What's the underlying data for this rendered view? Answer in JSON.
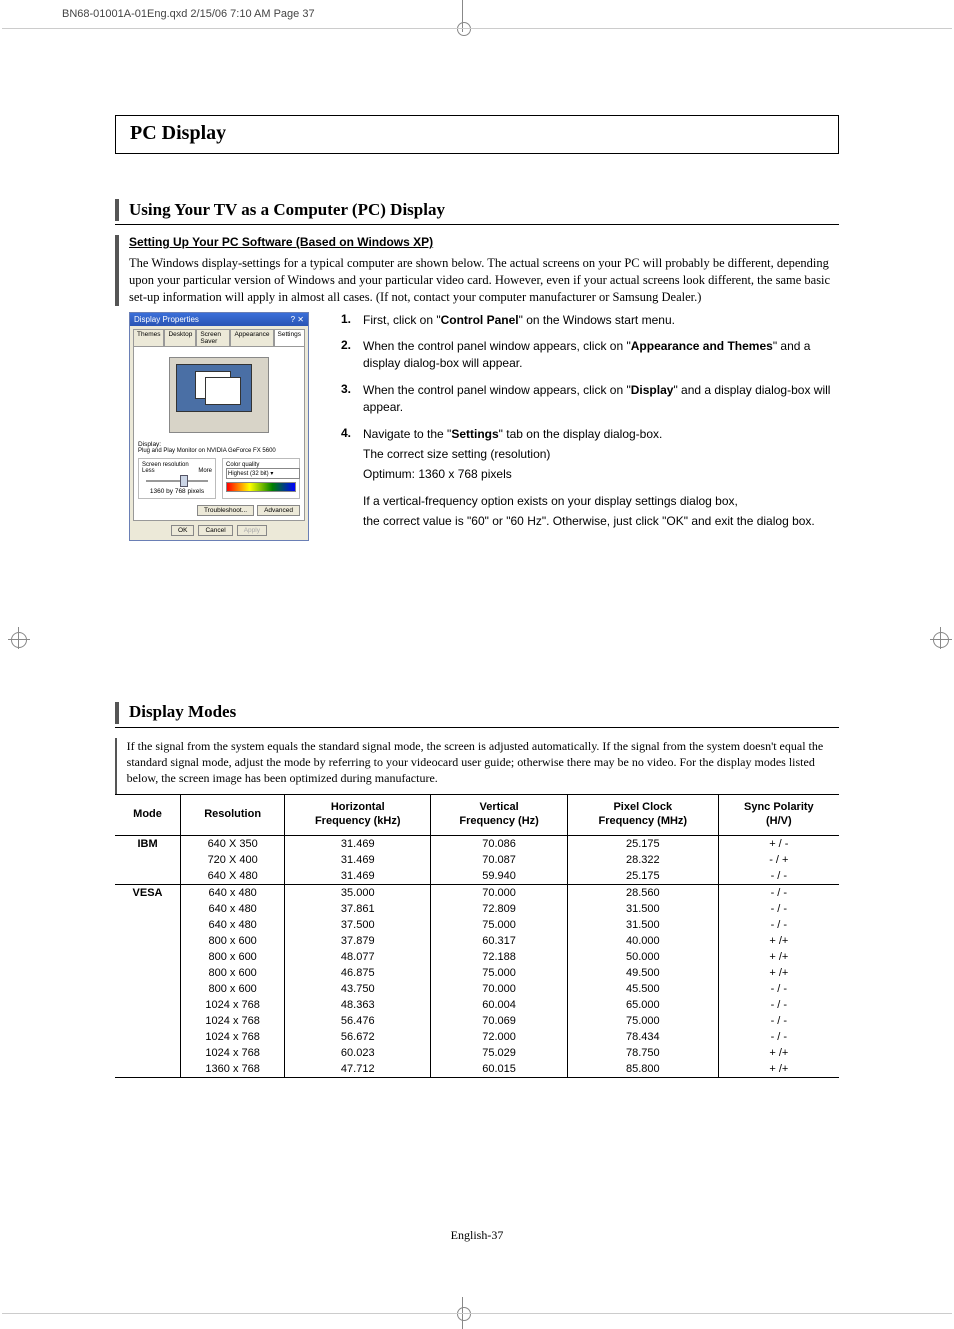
{
  "print_header": "BN68-01001A-01Eng.qxd  2/15/06  7:10 AM  Page 37",
  "section_title": "PC Display",
  "h1": "Using Your TV as a Computer (PC) Display",
  "subhead_setting": "Setting Up Your PC Software (Based on Windows XP)",
  "intro": "The Windows display-settings for a typical computer are shown below. The actual screens on your PC will probably be different, depending upon your particular version of Windows and your particular video card. However, even if your actual screens look different, the same basic set-up information will apply in almost all cases. (If not, contact your computer manufacturer or Samsung Dealer.)",
  "dialog": {
    "title": "Display Properties",
    "tabs": [
      "Themes",
      "Desktop",
      "Screen Saver",
      "Appearance",
      "Settings"
    ],
    "display_label": "Display:",
    "display_desc": "Plug and Play Monitor on NVIDIA GeForce FX 5600",
    "res_group": "Screen resolution",
    "less": "Less",
    "more": "More",
    "res_text": "1360 by 768 pixels",
    "quality_group": "Color quality",
    "quality_value": "Highest (32 bit)",
    "btn_trouble": "Troubleshoot...",
    "btn_adv": "Advanced",
    "btn_ok": "OK",
    "btn_cancel": "Cancel",
    "btn_apply": "Apply"
  },
  "steps": [
    {
      "num": "1.",
      "pre": "First, click on \"",
      "bold": "Control Panel",
      "post": "\" on the Windows start menu."
    },
    {
      "num": "2.",
      "pre": "When the control panel window appears, click on \"",
      "bold": "Appearance and Themes",
      "post": "\" and a display dialog-box will appear."
    },
    {
      "num": "3.",
      "pre": "When the control panel window appears, click on \"",
      "bold": "Display",
      "post": "\" and a display dialog-box will appear."
    },
    {
      "num": "4.",
      "pre": "Navigate to the \"",
      "bold": "Settings",
      "post": "\" tab on the display dialog-box."
    }
  ],
  "step4_extra1": "The correct size setting (resolution)",
  "step4_extra2": "Optimum: 1360 x 768 pixels",
  "step4_note1": "If a vertical-frequency option exists on your display settings dialog box,",
  "step4_note2": "the correct value is \"60\" or \"60 Hz\". Otherwise, just click \"OK\" and exit the dialog box.",
  "dm_head": "Display Modes",
  "dm_intro": "If the signal from the system equals the standard signal mode, the screen is adjusted automatically.  If the signal from the system doesn't equal the standard signal mode, adjust the mode by referring to your videocard user guide; otherwise there may be no video. For the display modes listed below, the screen image has been optimized during manufacture.",
  "table": {
    "headers": [
      "Mode",
      "Resolution",
      "Horizontal\nFrequency (kHz)",
      "Vertical\nFrequency (Hz)",
      "Pixel Clock\nFrequency (MHz)",
      "Sync Polarity\n(H/V)"
    ],
    "ibm": [
      [
        "640 X 350",
        "31.469",
        "70.086",
        "25.175",
        "+ / -"
      ],
      [
        "720 X 400",
        "31.469",
        "70.087",
        "28.322",
        "- / +"
      ],
      [
        "640 X 480",
        "31.469",
        "59.940",
        "25.175",
        "- / -"
      ]
    ],
    "vesa": [
      [
        "640 x 480",
        "35.000",
        "70.000",
        "28.560",
        "- / -"
      ],
      [
        "640 x 480",
        "37.861",
        "72.809",
        "31.500",
        "- / -"
      ],
      [
        "640 x 480",
        "37.500",
        "75.000",
        "31.500",
        "- / -"
      ],
      [
        "800 x 600",
        "37.879",
        "60.317",
        "40.000",
        "+ /+"
      ],
      [
        "800 x 600",
        "48.077",
        "72.188",
        "50.000",
        "+ /+"
      ],
      [
        "800 x 600",
        "46.875",
        "75.000",
        "49.500",
        "+ /+"
      ],
      [
        "800 x 600",
        "43.750",
        "70.000",
        "45.500",
        "- / -"
      ],
      [
        "1024 x 768",
        "48.363",
        "60.004",
        "65.000",
        "- / -"
      ],
      [
        "1024 x 768",
        "56.476",
        "70.069",
        "75.000",
        "- / -"
      ],
      [
        "1024 x 768",
        "56.672",
        "72.000",
        "78.434",
        "- / -"
      ],
      [
        "1024 x 768",
        "60.023",
        "75.029",
        "78.750",
        "+ /+"
      ],
      [
        "1360 x 768",
        "47.712",
        "60.015",
        "85.800",
        "+ /+"
      ]
    ],
    "ibm_label": "IBM",
    "vesa_label": "VESA"
  },
  "page_num": "English-37"
}
